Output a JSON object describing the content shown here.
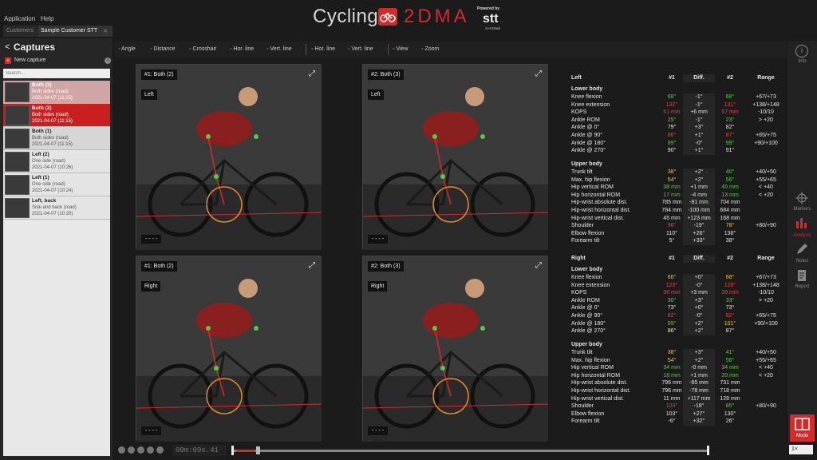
{
  "menu": {
    "application": "Application",
    "help": "Help"
  },
  "logo": {
    "cycling": "Cycling",
    "brand": "2DMA",
    "powered": "Powered by",
    "stt": "stt",
    "stt_sub": "SYSTEMS"
  },
  "tabs": {
    "customers": "Customers",
    "active": "Sample Customer STT",
    "close": "✕"
  },
  "sidebar": {
    "title": "Captures",
    "new_capture": "New capture",
    "search_placeholder": "Search...",
    "items": [
      {
        "title": "Both (3)",
        "desc": "Both sides (road)",
        "date": "2021-04-07 (11:15)",
        "state": "faded"
      },
      {
        "title": "Both (2)",
        "desc": "Both sides (road)",
        "date": "2021-04-07 (11:15)",
        "state": "selected"
      },
      {
        "title": "Both (1)",
        "desc": "Both sides (road)",
        "date": "2021-04-07 (11:15)",
        "state": "normal"
      },
      {
        "title": "Left (2)",
        "desc": "One side (road)",
        "date": "2021-04-07 (10:26)",
        "state": "normal"
      },
      {
        "title": "Left (1)",
        "desc": "One side (road)",
        "date": "2021-04-07 (10:24)",
        "state": "normal"
      },
      {
        "title": "Left, back",
        "desc": "Side and back (road)",
        "date": "2021-04-07 (10:20)",
        "state": "normal"
      }
    ]
  },
  "toolbar": [
    "Angle",
    "Distance",
    "Crosshair",
    "Hor. line",
    "Vert. line",
    "Hor. line",
    "Vert. line",
    "View",
    "Zoom"
  ],
  "panels": [
    {
      "label": "#1: Both (2)",
      "side": "Left",
      "dots": "- - - -"
    },
    {
      "label": "#2: Both (3)",
      "side": "Left",
      "dots": "- - - -"
    },
    {
      "label": "#1: Both (2)",
      "side": "Right",
      "dots": "- - - -"
    },
    {
      "label": "#2: Both (3)",
      "side": "Right",
      "dots": "- - - -"
    }
  ],
  "table": {
    "headers": {
      "c1": "#1",
      "c2": "Diff.",
      "c3": "#2",
      "c4": "Range"
    },
    "left": {
      "title": "Left",
      "lower": "Lower body",
      "lower_rows": [
        [
          "Knee flexion",
          "68°",
          "g",
          "-1°",
          "68°",
          "g",
          "+67/+73"
        ],
        [
          "Knee extension",
          "132°",
          "r",
          "-1°",
          "131°",
          "r",
          "+138/+148"
        ],
        [
          "KOPS",
          "51 mm",
          "r",
          "+6 mm",
          "57 mm",
          "r",
          "-10/10"
        ],
        [
          "Ankle ROM",
          "25°",
          "g",
          "-1°",
          "23°",
          "g",
          "> +20"
        ],
        [
          "Ankle @ 0°",
          "79°",
          "w",
          "+3°",
          "82°",
          "w",
          ""
        ],
        [
          "Ankle @ 90°",
          "86°",
          "r",
          "+1°",
          "87°",
          "r",
          "+65/+75"
        ],
        [
          "Ankle @ 180°",
          "99°",
          "g",
          "-0°",
          "99°",
          "g",
          "+90/+100"
        ],
        [
          "Ankle @ 270°",
          "90°",
          "w",
          "+1°",
          "91°",
          "w",
          ""
        ]
      ],
      "upper": "Upper body",
      "upper_rows": [
        [
          "Trunk tilt",
          "38°",
          "y",
          "+2°",
          "40°",
          "g",
          "+40/+50"
        ],
        [
          "Max. hip flexion",
          "54°",
          "y",
          "+2°",
          "56°",
          "g",
          "+55/+65"
        ],
        [
          "Hip vertical ROM",
          "38 mm",
          "g",
          "+1 mm",
          "40 mm",
          "g",
          "< +40"
        ],
        [
          "Hip horizontal ROM",
          "17 mm",
          "g",
          "-4 mm",
          "13 mm",
          "g",
          "< +20"
        ],
        [
          "Hip-wrist absolute dist.",
          "785 mm",
          "w",
          "-81 mm",
          "704 mm",
          "w",
          ""
        ],
        [
          "Hip-wrist horizontal dist.",
          "784 mm",
          "w",
          "-100 mm",
          "684 mm",
          "w",
          ""
        ],
        [
          "Hip-wrist vertical dist.",
          "45 mm",
          "w",
          "+123 mm",
          "168 mm",
          "w",
          ""
        ],
        [
          "Shoulder",
          "96°",
          "r",
          "-19°",
          "78°",
          "y",
          "+80/+90"
        ],
        [
          "Elbow flexion",
          "110°",
          "w",
          "+26°",
          "136°",
          "w",
          ""
        ],
        [
          "Forearm tilt",
          "5°",
          "w",
          "+33°",
          "38°",
          "w",
          ""
        ]
      ]
    },
    "right": {
      "title": "Right",
      "lower": "Lower body",
      "lower_rows": [
        [
          "Knee flexion",
          "66°",
          "y",
          "+0°",
          "66°",
          "y",
          "+67/+73"
        ],
        [
          "Knee extension",
          "129°",
          "r",
          "-0°",
          "128°",
          "r",
          "+138/+148"
        ],
        [
          "KOPS",
          "36 mm",
          "r",
          "+3 mm",
          "39 mm",
          "r",
          "-10/10"
        ],
        [
          "Ankle ROM",
          "30°",
          "g",
          "+3°",
          "33°",
          "g",
          "> +20"
        ],
        [
          "Ankle @ 0°",
          "73°",
          "w",
          "+0°",
          "73°",
          "w",
          ""
        ],
        [
          "Ankle @ 90°",
          "82°",
          "r",
          "-0°",
          "82°",
          "r",
          "+65/+75"
        ],
        [
          "Ankle @ 180°",
          "99°",
          "g",
          "+2°",
          "101°",
          "y",
          "+90/+100"
        ],
        [
          "Ankle @ 270°",
          "86°",
          "w",
          "+2°",
          "87°",
          "w",
          ""
        ]
      ],
      "upper": "Upper body",
      "upper_rows": [
        [
          "Trunk tilt",
          "38°",
          "y",
          "+3°",
          "41°",
          "g",
          "+40/+50"
        ],
        [
          "Max. hip flexion",
          "54°",
          "y",
          "+2°",
          "56°",
          "g",
          "+55/+65"
        ],
        [
          "Hip vertical ROM",
          "34 mm",
          "g",
          "-0 mm",
          "34 mm",
          "g",
          "< +40"
        ],
        [
          "Hip horizontal ROM",
          "18 mm",
          "g",
          "+1 mm",
          "20 mm",
          "g",
          "< +20"
        ],
        [
          "Hip-wrist absolute dist.",
          "796 mm",
          "w",
          "-65 mm",
          "731 mm",
          "w",
          ""
        ],
        [
          "Hip-wrist horizontal dist.",
          "796 mm",
          "w",
          "-78 mm",
          "718 mm",
          "w",
          ""
        ],
        [
          "Hip-wrist vertical dist.",
          "11 mm",
          "w",
          "+117 mm",
          "128 mm",
          "w",
          ""
        ],
        [
          "Shoulder",
          "103°",
          "r",
          "-18°",
          "85°",
          "g",
          "+80/+90"
        ],
        [
          "Elbow flexion",
          "103°",
          "w",
          "+27°",
          "130°",
          "w",
          ""
        ],
        [
          "Forearm tilt",
          "-6°",
          "w",
          "+32°",
          "26°",
          "w",
          ""
        ]
      ]
    }
  },
  "rightbar": {
    "info": "Info",
    "markers": "Markers",
    "analysis": "Analysis",
    "notes": "Notes",
    "report": "Report",
    "mode": "Mode"
  },
  "player": {
    "timecode": "00m:00s.41",
    "speed": "1×",
    "progress": 0.04
  },
  "colors": {
    "accent": "#d22b2b",
    "green": "#5cc843",
    "red": "#e24343",
    "yellow": "#e2c940"
  }
}
